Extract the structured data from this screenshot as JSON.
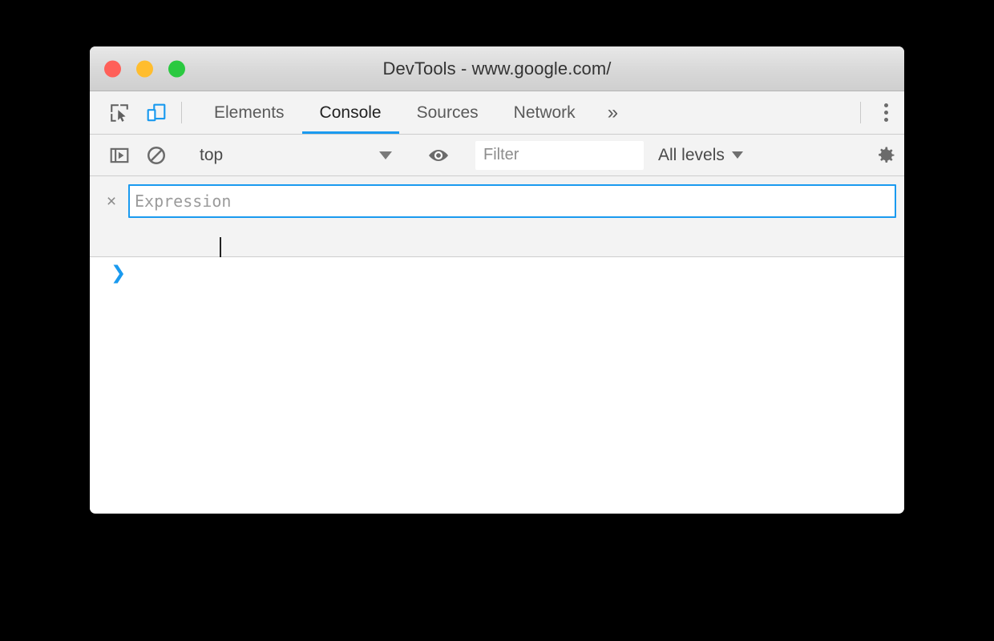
{
  "window": {
    "title": "DevTools - www.google.com/",
    "controls": [
      {
        "name": "close",
        "color": "#ff6059"
      },
      {
        "name": "minimize",
        "color": "#ffbd2e"
      },
      {
        "name": "maximize",
        "color": "#2ac940"
      }
    ]
  },
  "tabbar": {
    "inspect_icon": "inspect-element-icon",
    "device_icon": "device-toolbar-icon",
    "tabs": [
      {
        "label": "Elements",
        "active": false
      },
      {
        "label": "Console",
        "active": true
      },
      {
        "label": "Sources",
        "active": false
      },
      {
        "label": "Network",
        "active": false
      }
    ],
    "more_tabs_label": "»",
    "menu_icon": "more-vertical-icon"
  },
  "console_toolbar": {
    "sidebar_icon": "console-sidebar-icon",
    "clear_icon": "clear-console-icon",
    "context": {
      "value": "top",
      "caret": "chevron-down-icon"
    },
    "eye_icon": "create-live-expression-icon",
    "filter": {
      "value": "",
      "placeholder": "Filter"
    },
    "levels": {
      "value": "All levels",
      "caret": "chevron-down-icon"
    },
    "settings_icon": "settings-gear-icon"
  },
  "live_expression": {
    "remove_label": "×",
    "input": {
      "value": "",
      "placeholder": "Expression"
    }
  },
  "console_body": {
    "prompt": "❯"
  },
  "colors": {
    "accent": "#1a9aef",
    "toolbar_bg": "#f3f3f3",
    "titlebar_bg": "#d8d8d8",
    "border": "#cdcdcd",
    "text": "#4a4a4a"
  }
}
